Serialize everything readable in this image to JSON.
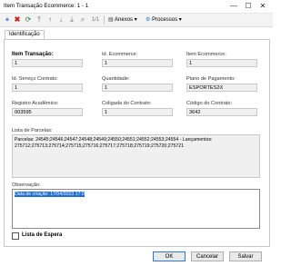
{
  "window": {
    "title": "Item Transação Ecommerce: 1 - 1",
    "minimize": "—",
    "maximize": "☐",
    "close": "✕"
  },
  "toolbar": {
    "pager": "1/1",
    "anexos": "Anexos",
    "processos": "Processos"
  },
  "tabs": [
    {
      "label": "Identificação"
    }
  ],
  "form": {
    "item_transacao": {
      "label": "Item Transação:",
      "value": "1"
    },
    "id_ecommerce": {
      "label": "Id. Ecommerce:",
      "value": "1"
    },
    "item_ecommerce": {
      "label": "Item Ecommerce:",
      "value": "1"
    },
    "id_servico_contrato": {
      "label": "Id. Serviço Contrato:",
      "value": "1"
    },
    "quantidade": {
      "label": "Quantidade:",
      "value": "1"
    },
    "plano_pagamento": {
      "label": "Plano de Pagamento:",
      "value": "ESPORTES2X"
    },
    "registro_academico": {
      "label": "Registro Acadêmico:",
      "value": "003595"
    },
    "coligada_contrato": {
      "label": "Coligada do Contrato:",
      "value": "1"
    },
    "codigo_contrato": {
      "label": "Código do Contrato:",
      "value": "3642"
    },
    "lista_parcelas": {
      "label": "Lista de Parcelas:",
      "value": "Parcelas: 24545;24546;24547;24548;24549;24550;24551;24552;24553;24554 - Lançamentos: 275712;275713;275714;275715;275716;275717;275718;275719;275720;275721"
    },
    "observacao": {
      "label": "Observação:",
      "value": "Data de criação: 17/04/2023 17:0"
    },
    "lista_espera": {
      "label": "Lista de Espera"
    }
  },
  "footer": {
    "ok": "OK",
    "cancelar": "Cancelar",
    "salvar": "Salvar"
  }
}
